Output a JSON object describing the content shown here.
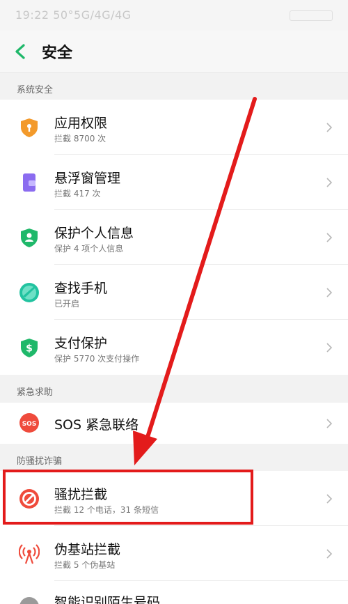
{
  "status_bar": {
    "time": "19:22 50°5G/4G/4G"
  },
  "header": {
    "title": "安全"
  },
  "sections": [
    {
      "label": "系统安全"
    },
    {
      "label": "紧急求助"
    },
    {
      "label": "防骚扰诈骗"
    }
  ],
  "items": [
    {
      "title": "应用权限",
      "subtitle": "拦截 8700 次",
      "icon": "shield-keyhole-icon",
      "color": "#f39a2b"
    },
    {
      "title": "悬浮窗管理",
      "subtitle": "拦截 417 次",
      "icon": "floating-window-icon",
      "color": "#8b6cf0"
    },
    {
      "title": "保护个人信息",
      "subtitle": "保护 4 项个人信息",
      "icon": "shield-person-icon",
      "color": "#1fb86a"
    },
    {
      "title": "查找手机",
      "subtitle": "已开启",
      "icon": "locate-phone-icon",
      "color": "#22c3a0"
    },
    {
      "title": "支付保护",
      "subtitle": "保护 5770 次支付操作",
      "icon": "shield-dollar-icon",
      "color": "#1fb86a"
    },
    {
      "title": "SOS 紧急联络",
      "subtitle": "",
      "icon": "sos-icon",
      "color": "#ef4b3c"
    },
    {
      "title": "骚扰拦截",
      "subtitle": "拦截 12 个电话，31 条短信",
      "icon": "block-icon",
      "color": "#ef4b3c"
    },
    {
      "title": "伪基站拦截",
      "subtitle": "拦截 5 个伪基站",
      "icon": "signal-tower-icon",
      "color": "#ef4b3c"
    },
    {
      "title": "智能识别陌生号码",
      "subtitle": "",
      "icon": "number-id-icon",
      "color": "#9a9a9a"
    }
  ],
  "annotation": {
    "color": "#e31b1b"
  }
}
